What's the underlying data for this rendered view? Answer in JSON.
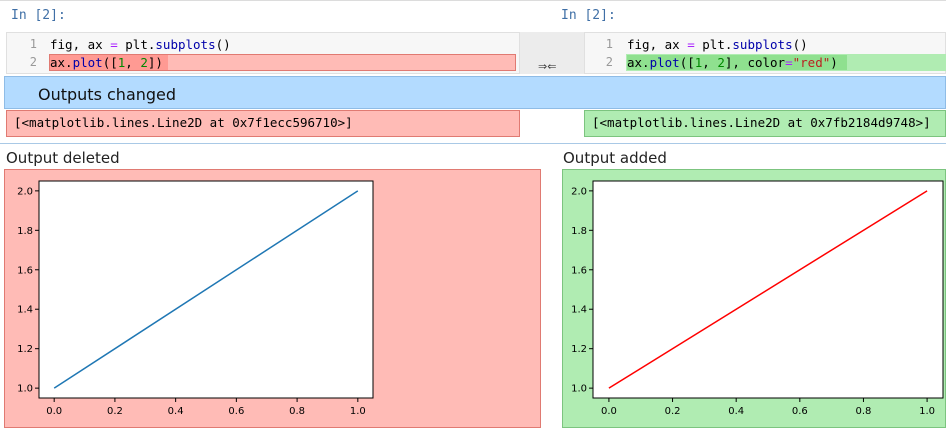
{
  "left_cell": {
    "prompt": "In [2]:",
    "line_numbers": [
      "1",
      "2"
    ],
    "code_lines": [
      "fig, ax = plt.subplots()",
      "ax.plot([1, 2])"
    ]
  },
  "right_cell": {
    "prompt": "In [2]:",
    "line_numbers": [
      "1",
      "2"
    ],
    "code_lines": [
      "fig, ax = plt.subplots()",
      "ax.plot([1, 2], color=\"red\")"
    ]
  },
  "merge_arrows": "⇒⇐",
  "banner": {
    "title": "Outputs changed"
  },
  "outputs": {
    "left_text": "[<matplotlib.lines.Line2D at 0x7f1ecc596710>]",
    "right_text": "[<matplotlib.lines.Line2D at 0x7fb2184d9748>]",
    "deleted_label": "Output deleted",
    "added_label": "Output added"
  },
  "colors": {
    "deleted_bg": "#ffbbb6",
    "deleted_highlight": "#ff9a93",
    "added_bg": "#b0ecb2",
    "added_highlight": "#8fe08f",
    "banner_bg": "#b3dbff",
    "left_line": "#1f77b4",
    "right_line": "#ff0000"
  },
  "chart_data": [
    {
      "type": "line",
      "x": [
        0,
        1
      ],
      "series": [
        {
          "values": [
            1,
            2
          ],
          "color": "#1f77b4"
        }
      ],
      "xlim": [
        -0.05,
        1.05
      ],
      "ylim": [
        0.95,
        2.05
      ],
      "xticks": [
        "0.0",
        "0.2",
        "0.4",
        "0.6",
        "0.8",
        "1.0"
      ],
      "yticks": [
        "1.0",
        "1.2",
        "1.4",
        "1.6",
        "1.8",
        "2.0"
      ],
      "grid": false
    },
    {
      "type": "line",
      "x": [
        0,
        1
      ],
      "series": [
        {
          "values": [
            1,
            2
          ],
          "color": "#ff0000"
        }
      ],
      "xlim": [
        -0.05,
        1.05
      ],
      "ylim": [
        0.95,
        2.05
      ],
      "xticks": [
        "0.0",
        "0.2",
        "0.4",
        "0.6",
        "0.8",
        "1.0"
      ],
      "yticks": [
        "1.0",
        "1.2",
        "1.4",
        "1.6",
        "1.8",
        "2.0"
      ],
      "grid": false
    }
  ]
}
